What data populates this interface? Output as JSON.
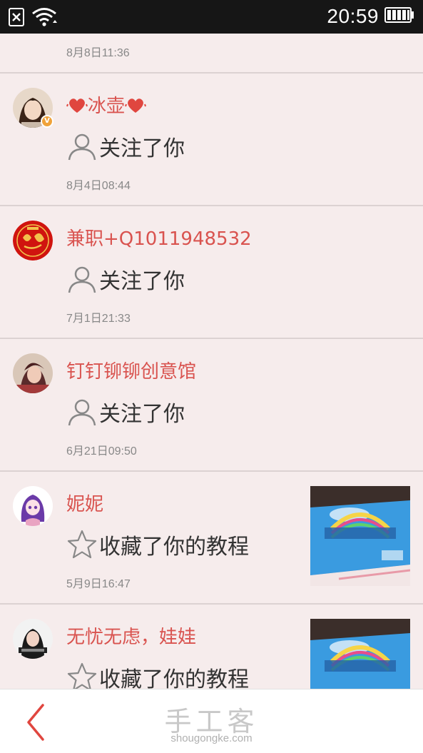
{
  "status_bar": {
    "time": "20:59",
    "icons": [
      "sim-missing-icon",
      "wifi-icon",
      "battery-icon"
    ]
  },
  "feed": {
    "partial_item": {
      "time": "8月8日11:36"
    },
    "items": [
      {
        "name": "冰壶",
        "name_decor": "heart-icon",
        "verified": true,
        "action": "关注了你",
        "action_icon": "person-icon",
        "time": "8月4日08:44",
        "has_thumbnail": false
      },
      {
        "name": "兼职+Q1011948532",
        "verified": false,
        "action": "关注了你",
        "action_icon": "person-icon",
        "time": "7月1日21:33",
        "has_thumbnail": false
      },
      {
        "name": "钉钉铆铆创意馆",
        "verified": false,
        "action": "关注了你",
        "action_icon": "person-icon",
        "time": "6月21日09:50",
        "has_thumbnail": false
      },
      {
        "name": "妮妮",
        "verified": false,
        "action": "收藏了你的教程",
        "action_icon": "star-icon",
        "time": "5月9日16:47",
        "has_thumbnail": true
      },
      {
        "name": "无忧无虑，娃娃",
        "verified": false,
        "action": "收藏了你的教程",
        "action_icon": "star-icon",
        "time": "",
        "has_thumbnail": true
      }
    ]
  },
  "bottom_bar": {
    "back_icon": "chevron-left-icon",
    "brand_cn": "手工客",
    "brand_en": "shougongke.com"
  },
  "colors": {
    "name": "#d9534f",
    "background": "#f6ecec",
    "back_arrow": "#e0463f",
    "status_bar": "#161616"
  }
}
